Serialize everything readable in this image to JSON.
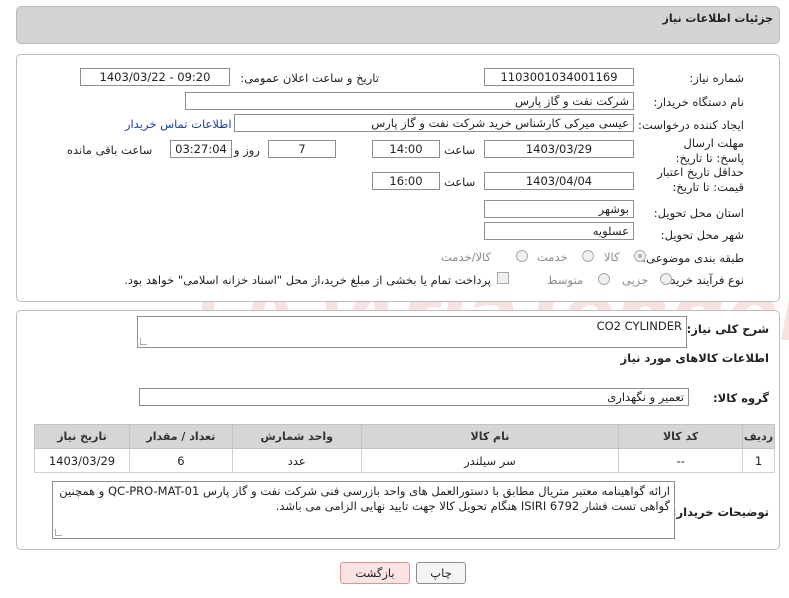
{
  "header": {
    "title": "جزئیات اطلاعات نیاز"
  },
  "form": {
    "need_number_label": "شماره نیاز:",
    "need_number": "1103001034001169",
    "announce_label": "تاریخ و ساعت اعلان عمومی:",
    "announce_value": "1403/03/22 - 09:20",
    "buyer_org_label": "نام دستگاه خریدار:",
    "buyer_org": "شرکت نفت و گاز پارس",
    "creator_label": "ایجاد کننده درخواست:",
    "creator": "عیسی میرکی کارشناس خرید شرکت نفت و گاز پارس",
    "contact_link": "اطلاعات تماس خریدار",
    "deadline_label": "مهلت ارسال پاسخ: تا تاریخ:",
    "deadline_date": "1403/03/29",
    "time_label": "ساعت",
    "deadline_time": "14:00",
    "days_value": "7",
    "days_label": "روز و",
    "remaining_time": "03:27:04",
    "remaining_label": "ساعت باقی مانده",
    "validity_label": "حداقل تاریخ اعتبار قیمت: تا تاریخ:",
    "validity_date": "1403/04/04",
    "validity_time": "16:00",
    "province_label": "استان محل تحویل:",
    "province": "بوشهر",
    "city_label": "شهر محل تحویل:",
    "city": "عسلویه",
    "category_label": "طبقه بندی موضوعی:",
    "category_options": [
      "کالا",
      "خدمت",
      "کالا/خدمت"
    ],
    "process_label": "نوع فرآیند خرید :",
    "process_options": [
      "جزیی",
      "متوسط"
    ],
    "payment_note": "پرداخت تمام یا بخشی از مبلغ خرید،از محل \"اسناد خزانه اسلامی\" خواهد بود."
  },
  "details": {
    "description_label": "شرح کلی نیاز:",
    "description": "CO2 CYLINDER",
    "goods_info_title": "اطلاعات کالاهای مورد نیاز",
    "group_label": "گروه کالا:",
    "group_value": "تعمیر و نگهداری"
  },
  "table": {
    "headers": [
      "ردیف",
      "کد کالا",
      "نام کالا",
      "واحد شمارش",
      "تعداد / مقدار",
      "تاریخ نیاز"
    ],
    "rows": [
      [
        "1",
        "--",
        "سر سیلندر",
        "عدد",
        "6",
        "1403/03/29"
      ]
    ]
  },
  "notes": {
    "label": "توضیحات خریدار:",
    "text": "ارائه گواهینامه معتبر متریال مطابق با دستورالعمل های واحد بازرسی فنی شرکت نفت و گاز پارس QC-PRO-MAT-01 و همچنین گواهی تست فشار ISIRI 6792 هنگام تحویل کالا جهت تایید نهایی الزامی می باشد."
  },
  "buttons": {
    "print": "چاپ",
    "back": "بازگشت"
  },
  "watermark_text": "AriaTender.neT",
  "colors": {
    "link": "#1c3fa8",
    "header_bg": "#d4d4d4",
    "back_button_bg": "#fbe3e3"
  }
}
